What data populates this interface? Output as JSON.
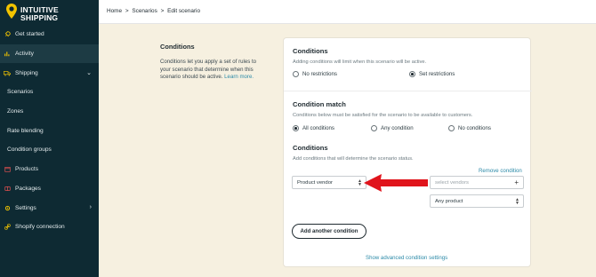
{
  "brand": {
    "name_line1": "INTUITIVE",
    "name_line2": "SHIPPING"
  },
  "breadcrumb": [
    "Home",
    "Scenarios",
    "Edit scenario"
  ],
  "breadcrumb_sep": ">",
  "sidebar": {
    "items": [
      {
        "label": "Get started",
        "icon": "rocket-icon"
      },
      {
        "label": "Activity",
        "icon": "chart-icon"
      },
      {
        "label": "Shipping",
        "icon": "truck-icon",
        "expanded": true
      },
      {
        "label": "Scenarios"
      },
      {
        "label": "Zones"
      },
      {
        "label": "Rate blending"
      },
      {
        "label": "Condition groups"
      },
      {
        "label": "Products",
        "icon": "box-icon"
      },
      {
        "label": "Packages",
        "icon": "package-icon"
      },
      {
        "label": "Settings",
        "icon": "gear-icon"
      },
      {
        "label": "Shopify connection",
        "icon": "link-icon"
      }
    ]
  },
  "description": {
    "title": "Conditions",
    "body": "Conditions let you apply a set of rules to your scenario that determine when this scenario should be active.",
    "link": "Learn more."
  },
  "conditions_section": {
    "title": "Conditions",
    "subtitle": "Adding conditions will limit when this scenario will be active.",
    "options": [
      "No restrictions",
      "Set restrictions"
    ],
    "selected": "Set restrictions"
  },
  "match_section": {
    "title": "Condition match",
    "subtitle": "Conditions below must be satisfied for the scenario to be available to customers.",
    "options": [
      "All conditions",
      "Any condition",
      "No conditions"
    ],
    "selected": "All conditions"
  },
  "rules_section": {
    "title": "Conditions",
    "subtitle": "Add conditions that will determine the scenario status.",
    "remove_label": "Remove condition",
    "field_select": "Product vendor",
    "vendor_placeholder": "select vendors",
    "product_select": "Any product",
    "add_button": "Add another condition",
    "advanced_link": "Show advanced condition settings"
  },
  "colors": {
    "sidebar": "#0e2a33",
    "accent": "#f2c400",
    "link": "#2c8aa8",
    "arrow": "#e0141c",
    "background": "#f6f0e0"
  }
}
